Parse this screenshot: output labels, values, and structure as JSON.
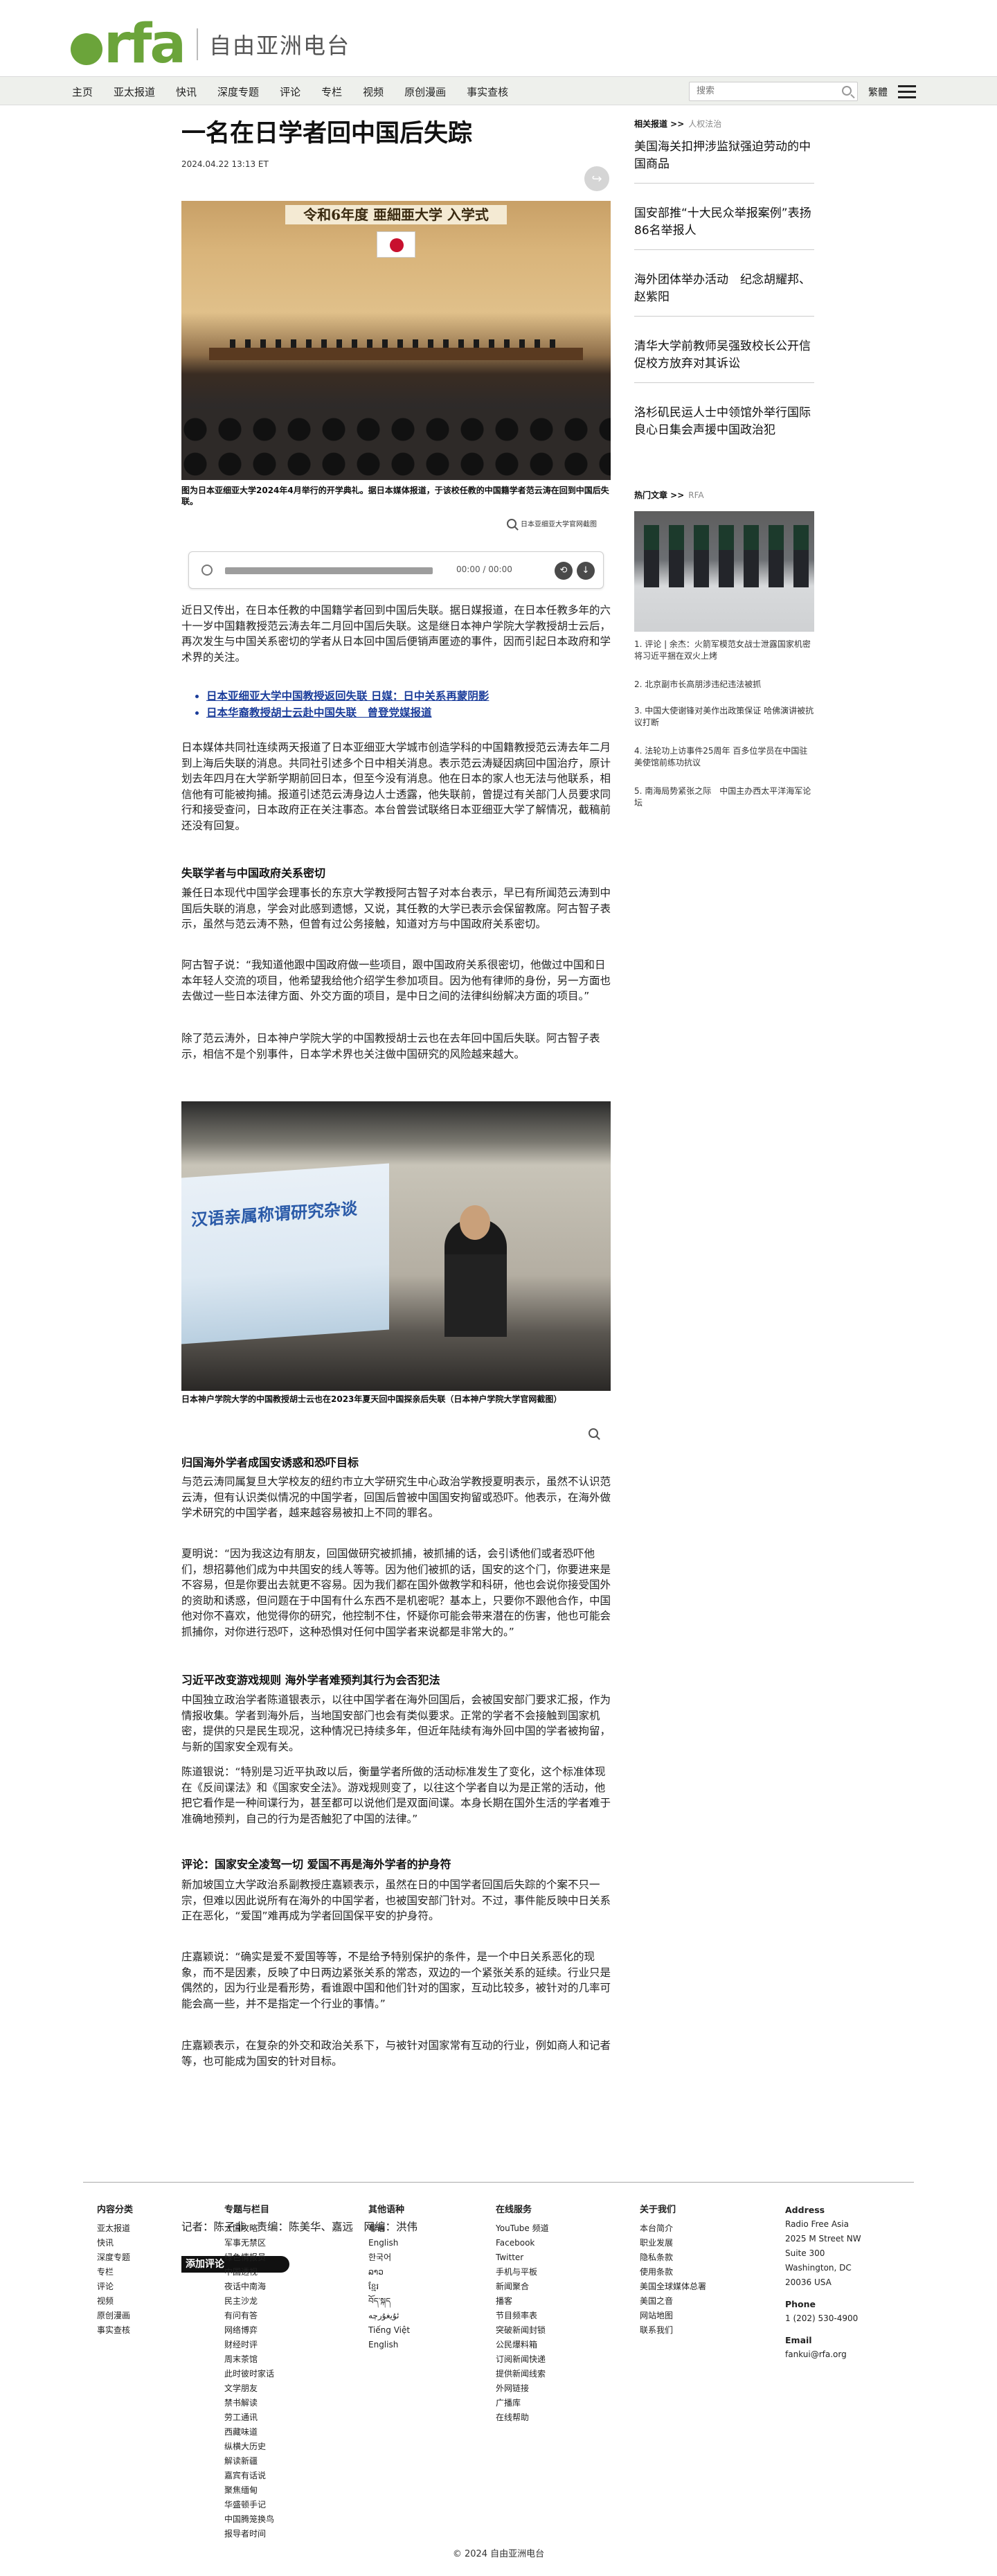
{
  "header": {
    "logo_text": "rfa",
    "logo_cn": "自由亚洲电台"
  },
  "nav": {
    "items": [
      "主页",
      "亚太报道",
      "快讯",
      "深度专题",
      "评论",
      "专栏",
      "视频",
      "原创漫画",
      "事实查核"
    ],
    "search_placeholder": "搜索",
    "lang_toggle": "繁體"
  },
  "article": {
    "headline": "一名在日学者回中国后失踪",
    "dateline": "2024.04.22 13:13 ET",
    "photo1_banner": "令和6年度 亜細亜大学 入学式",
    "photo1_caption": "图为日本亚细亚大学2024年4月举行的开学典礼。据日本媒体报道，于该校任教的中国籍学者范云涛在回到中国后失联。",
    "photo1_credit": "日本亚细亚大学官网截图",
    "audio_time": "00:00 / 00:00",
    "para1": "近日又传出，在日本任教的中国籍学者回到中国后失联。据日媒报道，在日本任教多年的六十一岁中国籍教授范云涛去年二月回中国后失联。这是继日本神户学院大学教授胡士云后，再次发生与中国关系密切的学者从日本回中国后便销声匿迹的事件，因而引起日本政府和学术界的关注。",
    "related_links": [
      "日本亚细亚大学中国教授返回失联 日媒：日中关系再蒙阴影",
      "日本华裔教授胡士云赴中国失联　曾登党媒报道"
    ],
    "para2": "日本媒体共同社连续两天报道了日本亚细亚大学城市创造学科的中国籍教授范云涛去年二月到上海后失联的消息。共同社引述多个日中相关消息。表示范云涛疑因病回中国治疗，原计划去年四月在大学新学期前回日本，但至今没有消息。他在日本的家人也无法与他联系，相信他有可能被拘捕。报道引述范云涛身边人士透露，他失联前，曾提过有关部门人员要求同行和接受查问，日本政府正在关注事态。本台曾尝试联络日本亚细亚大学了解情况，截稿前还没有回复。",
    "subhead1": "失联学者与中国政府关系密切",
    "para3": "兼任日本现代中国学会理事长的东京大学教授阿古智子对本台表示，早已有所闻范云涛到中国后失联的消息，学会对此感到遗憾，又说，其任教的大学已表示会保留教席。阿古智子表示，虽然与范云涛不熟，但曾有过公务接触，知道对方与中国政府关系密切。",
    "para4": "阿古智子说：“我知道他跟中国政府做一些项目，跟中国政府关系很密切，他做过中国和日本年轻人交流的项目，他希望我给他介绍学生参加项目。因为他有律师的身份，另一方面也去做过一些日本法律方面、外交方面的项目，是中日之间的法律纠纷解决方面的项目。”",
    "para5": "除了范云涛外，日本神户学院大学的中国教授胡士云也在去年回中国后失联。阿古智子表示，相信不是个别事件，日本学术界也关注做中国研究的风险越来越大。",
    "photo2_screen_title": "汉语亲属称谓研究杂谈",
    "photo2_caption": "日本神户学院大学的中国教授胡士云也在2023年夏天回中国探亲后失联（日本神户学院大学官网截图）",
    "subhead2": "归国海外学者成国安诱惑和恐吓目标",
    "para6": "与范云涛同属复旦大学校友的纽约市立大学研究生中心政治学教授夏明表示，虽然不认识范云涛，但有认识类似情况的中国学者，回国后曾被中国国安拘留或恐吓。他表示，在海外做学术研究的中国学者，越来越容易被扣上不同的罪名。",
    "para7": "夏明说：“因为我这边有朋友，回国做研究被抓捕，被抓捕的话，会引诱他们或者恐吓他们，想招募他们成为中共国安的线人等等。因为他们被抓的话，国安的这个门，你要进来是不容易，但是你要出去就更不容易。因为我们都在国外做教学和科研，他也会说你接受国外的资助和诱惑，但问题在于中国有什么东西不是机密呢？基本上，只要你不跟他合作，中国他对你不喜欢，他觉得你的研究，他控制不住，怀疑你可能会带来潜在的伤害，他也可能会抓捕你，对你进行恐吓，这种恐惧对任何中国学者来说都是非常大的。”",
    "subhead3": "习近平改变游戏规则 海外学者难预判其行为会否犯法",
    "para8": "中国独立政治学者陈道银表示，以往中国学者在海外回国后，会被国安部门要求汇报，作为情报收集。学者到海外后，当地国安部门也会有类似要求。正常的学者不会接触到国家机密，提供的只是民生现况，这种情况已持续多年，但近年陆续有海外回中国的学者被拘留，与新的国家安全观有关。",
    "para9": "陈道银说：“特别是习近平执政以后，衡量学者所做的活动标准发生了变化，这个标准体现在《反间谍法》和《国家安全法》。游戏规则变了，以往这个学者自以为是正常的活动，他把它看作是一种间谍行为，甚至都可以说他们是双面间谍。本身长期在国外生活的学者难于准确地预判，自己的行为是否触犯了中国的法律。”",
    "subhead4": "评论：国家安全凌驾一切 爱国不再是海外学者的护身符",
    "para10": "新加坡国立大学政治系副教授庄嘉颖表示，虽然在日的中国学者回国后失踪的个案不只一宗，但难以因此说所有在海外的中国学者，也被国安部门针对。不过，事件能反映中日关系正在恶化，“爱国”难再成为学者回国保平安的护身符。",
    "para11": "庄嘉颖说：“确实是爱不爱国等等，不是给予特别保护的条件，是一个中日关系恶化的现象，而不是因素，反映了中日两边紧张关系的常态，双边的一个紧张关系的延续。行业只是偶然的，因为行业是看形势，看谁跟中国和他们针对的国家，互动比较多，被针对的几率可能会高一些，并不是指定一个行业的事情。”",
    "para12": "庄嘉颖表示，在复杂的外交和政治关系下，与被针对国家常有互动的行业，例如商人和记者等，也可能成为国安的针对目标。",
    "byline": "记者：陈子非　责编：陈美华、嘉远　网编：洪伟",
    "comment_button": "添加评论"
  },
  "sidebar": {
    "related_title": "相关报道 >>",
    "related_tag": "人权法治",
    "related_items": [
      "美国海关扣押涉监狱强迫劳动的中国商品",
      "国安部推“十大民众举报案例”表扬86名举报人",
      "海外团体举办活动　纪念胡耀邦、赵紫阳",
      "清华大学前教师吴强致校长公开信　促校方放弃对其诉讼",
      "洛杉矶民运人士中领馆外举行国际良心日集会声援中国政治犯"
    ],
    "hot_title": "热门文章 >>",
    "hot_tag": "RFA",
    "hot_items": [
      "1. 评论 | 余杰：火箭军模范女战士泄露国家机密 将习近平捆在双火上烤",
      "2. 北京副市长高朋涉违纪违法被抓",
      "3. 中国大使谢锋对美作出政策保证 哈佛演讲被抗议打断",
      "4. 法轮功上访事件25周年 百多位学员在中国驻美使馆前练功抗议",
      "5. 南海局势紧张之际　中国主办西太平洋海军论坛"
    ]
  },
  "footer": {
    "col1": {
      "title": "内容分类",
      "items": [
        "亚太报道",
        "快讯",
        "深度专题",
        "专栏",
        "评论",
        "视频",
        "原创漫画",
        "事实查核"
      ]
    },
    "col2": {
      "title": "专题与栏目",
      "items": [
        "大国攻略",
        "军事无禁区",
        "绿色情报员",
        "中国透视",
        "夜话中南海",
        "民主沙龙",
        "有问有答",
        "网络博弈",
        "财经时评",
        "周末茶馆",
        "此时彼时家话",
        "文学朋友",
        "禁书解读",
        "劳工通讯",
        "西藏味道",
        "纵横大历史",
        "解读新疆",
        "嘉宾有话说",
        "聚焦缅甸",
        "华盛顿手记",
        "中国腾笼换鸟",
        "报导者时间"
      ]
    },
    "col3": {
      "title": "其他语种",
      "items": [
        "粵语",
        "English",
        "한국어",
        "ລາວ",
        "ខ្មែរ",
        "བོད་སྐད",
        "ئۇيغۇرچە",
        "Tiếng Việt",
        "English"
      ]
    },
    "col4": {
      "title": "在线服务",
      "items": [
        "YouTube 频道",
        "Facebook",
        "Twitter",
        "手机与平板",
        "新闻聚合",
        "播客",
        "节目频率表",
        "突破新闻封锁",
        "公民爆料箱",
        "订阅新闻快递",
        "提供新闻线索",
        "外网链接",
        "广播库",
        "在线帮助"
      ]
    },
    "col5": {
      "title": "关于我们",
      "items": [
        "本台简介",
        "职业发展",
        "隐私条款",
        "使用条款",
        "美国全球媒体总署",
        "美国之音",
        "网站地图",
        "联系我们"
      ]
    },
    "address_title": "Address",
    "address_lines": [
      "Radio Free Asia",
      "2025 M Street NW",
      "Suite 300",
      "Washington, DC",
      "20036 USA"
    ],
    "phone_title": "Phone",
    "phone": "1 (202) 530-4900",
    "email_title": "Email",
    "email": "fankui@rfa.org",
    "copyright": "© 2024 自由亚洲电台"
  }
}
